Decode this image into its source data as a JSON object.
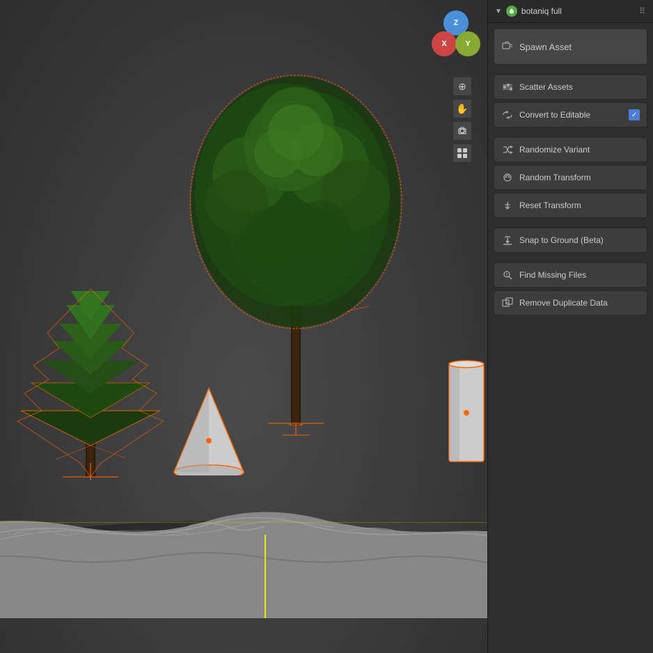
{
  "viewport": {
    "background": "#454545"
  },
  "axis_gizmo": {
    "z_label": "Z",
    "x_label": "X",
    "y_label": "Y"
  },
  "toolbar": {
    "tools": [
      {
        "name": "zoom",
        "icon": "⊕"
      },
      {
        "name": "grab",
        "icon": "✋"
      },
      {
        "name": "camera",
        "icon": "🎥"
      },
      {
        "name": "grid",
        "icon": "▦"
      }
    ]
  },
  "panel": {
    "header": {
      "title": "botaniq full",
      "arrow": "▼",
      "dots": "⠿"
    },
    "buttons": [
      {
        "id": "spawn-asset",
        "label": "Spawn Asset",
        "icon": "spawn",
        "large": true,
        "has_checkbox": false
      },
      {
        "id": "scatter-assets",
        "label": "Scatter Assets",
        "icon": "scatter",
        "large": false,
        "has_checkbox": false
      },
      {
        "id": "convert-to-editable",
        "label": "Convert to Editable",
        "icon": "convert",
        "large": false,
        "has_checkbox": true
      },
      {
        "id": "randomize-variant",
        "label": "Randomize Variant",
        "icon": "randomize",
        "large": false,
        "has_checkbox": false
      },
      {
        "id": "random-transform",
        "label": "Random Transform",
        "icon": "transform",
        "large": false,
        "has_checkbox": false
      },
      {
        "id": "reset-transform",
        "label": "Reset Transform",
        "icon": "reset",
        "large": false,
        "has_checkbox": false
      },
      {
        "id": "snap-to-ground",
        "label": "Snap to Ground (Beta)",
        "icon": "snap",
        "large": false,
        "has_checkbox": false
      },
      {
        "id": "find-missing-files",
        "label": "Find Missing Files",
        "icon": "find",
        "large": false,
        "has_checkbox": false
      },
      {
        "id": "remove-duplicate-data",
        "label": "Remove Duplicate Data",
        "icon": "remove",
        "large": false,
        "has_checkbox": false
      }
    ]
  }
}
